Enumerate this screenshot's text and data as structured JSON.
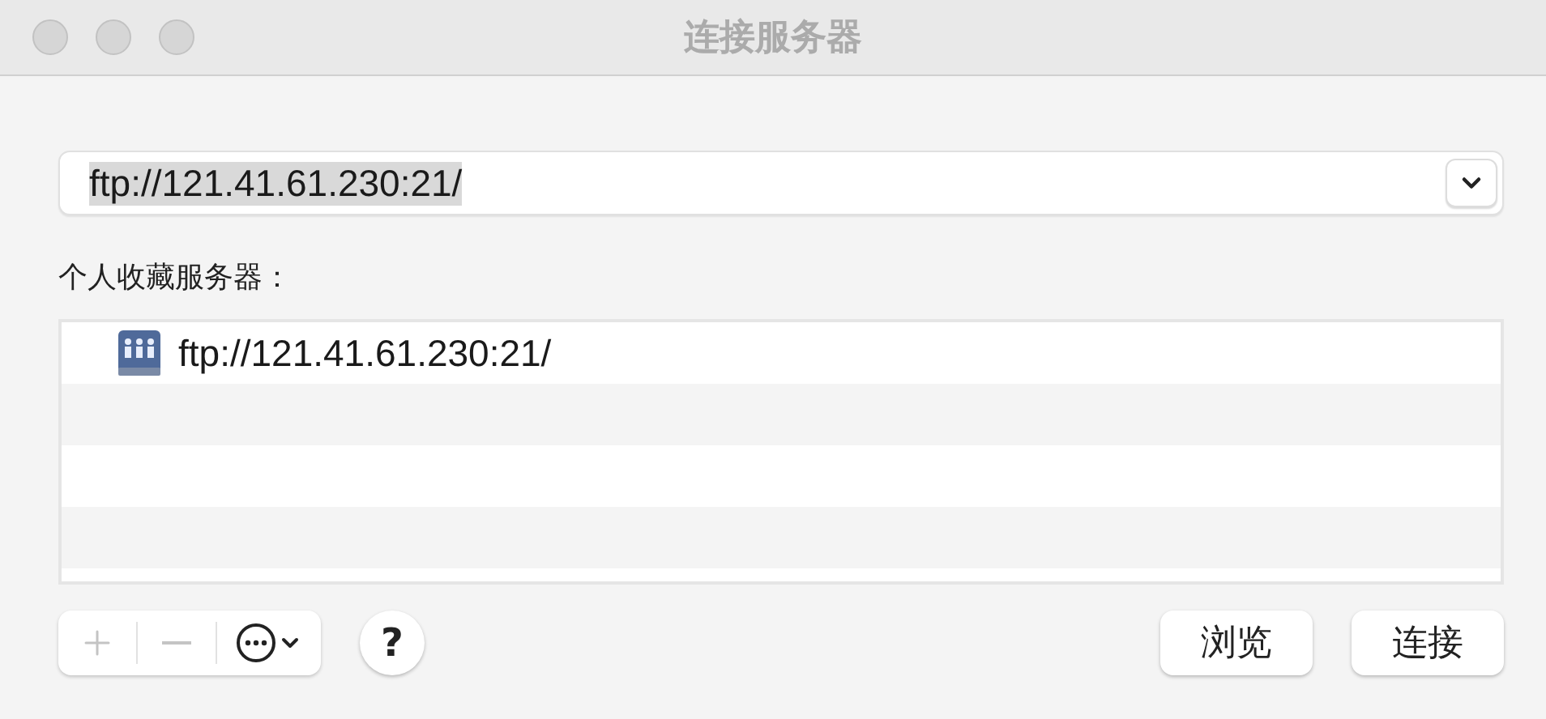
{
  "window": {
    "title": "连接服务器"
  },
  "address": {
    "value": "ftp://121.41.61.230:21/",
    "text_selected": true
  },
  "favorites": {
    "label": "个人收藏服务器：",
    "items": [
      {
        "label": "ftp://121.41.61.230:21/"
      }
    ]
  },
  "toolbar": {
    "add": {
      "disabled": true
    },
    "remove": {
      "disabled": true
    },
    "help": "?"
  },
  "buttons": [
    {
      "label": "浏览"
    },
    {
      "label": "连接"
    }
  ]
}
